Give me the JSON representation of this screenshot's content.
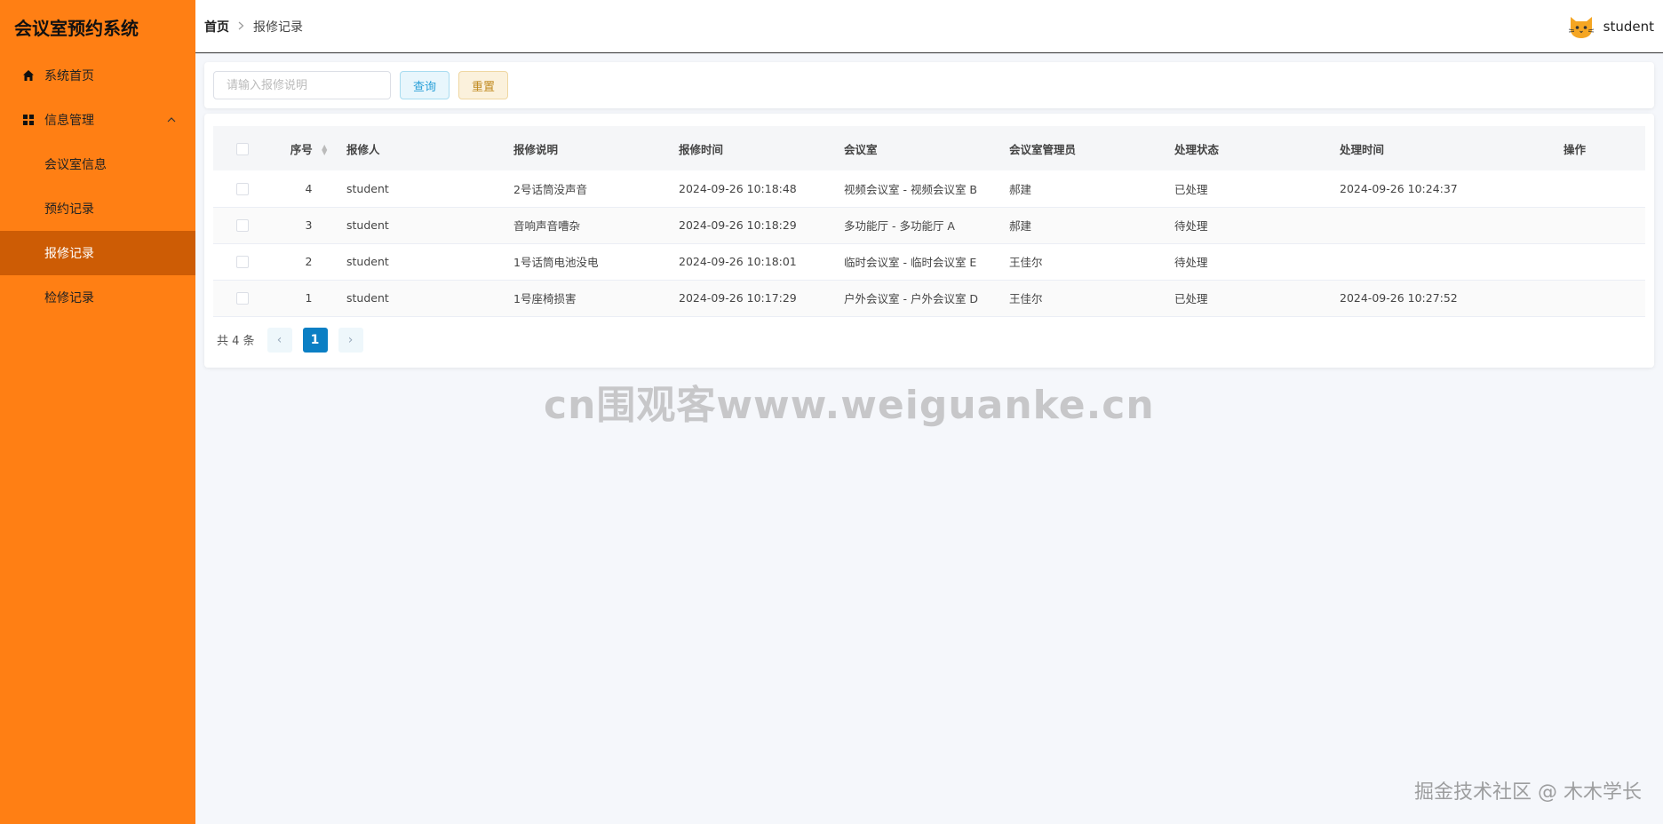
{
  "app": {
    "title": "会议室预约系统"
  },
  "sidebar": {
    "items": [
      {
        "label": "系统首页",
        "icon": "home-icon"
      },
      {
        "label": "信息管理",
        "icon": "grid-icon"
      },
      {
        "label": "会议室信息"
      },
      {
        "label": "预约记录"
      },
      {
        "label": "报修记录"
      },
      {
        "label": "检修记录"
      }
    ],
    "active_index": 4
  },
  "header": {
    "breadcrumb": {
      "home": "首页",
      "current": "报修记录"
    },
    "user": "student"
  },
  "search": {
    "placeholder": "请输入报修说明",
    "query_label": "查询",
    "reset_label": "重置"
  },
  "table": {
    "columns": [
      "序号",
      "报修人",
      "报修说明",
      "报修时间",
      "会议室",
      "会议室管理员",
      "处理状态",
      "处理时间",
      "操作"
    ],
    "rows": [
      {
        "id": "4",
        "reporter": "student",
        "desc": "2号话筒没声音",
        "time": "2024-09-26 10:18:48",
        "room": "视频会议室 - 视频会议室 B",
        "admin": "郝建",
        "status": "已处理",
        "handled": "2024-09-26 10:24:37"
      },
      {
        "id": "3",
        "reporter": "student",
        "desc": "音响声音嘈杂",
        "time": "2024-09-26 10:18:29",
        "room": "多功能厅 - 多功能厅 A",
        "admin": "郝建",
        "status": "待处理",
        "handled": ""
      },
      {
        "id": "2",
        "reporter": "student",
        "desc": "1号话筒电池没电",
        "time": "2024-09-26 10:18:01",
        "room": "临时会议室 - 临时会议室 E",
        "admin": "王佳尔",
        "status": "待处理",
        "handled": ""
      },
      {
        "id": "1",
        "reporter": "student",
        "desc": "1号座椅损害",
        "time": "2024-09-26 10:17:29",
        "room": "户外会议室 - 户外会议室 D",
        "admin": "王佳尔",
        "status": "已处理",
        "handled": "2024-09-26 10:27:52"
      }
    ]
  },
  "pagination": {
    "total": "共 4 条",
    "current": "1",
    "prev": "‹",
    "next": "›"
  },
  "watermark": "cn围观客www.weiguanke.cn",
  "footer_mark": "掘金技术社区 @ 木木学长",
  "colors": {
    "sidebar_bg": "#ff7f14",
    "active_bg": "#cd5c05",
    "page_current": "#0b7fc4"
  }
}
